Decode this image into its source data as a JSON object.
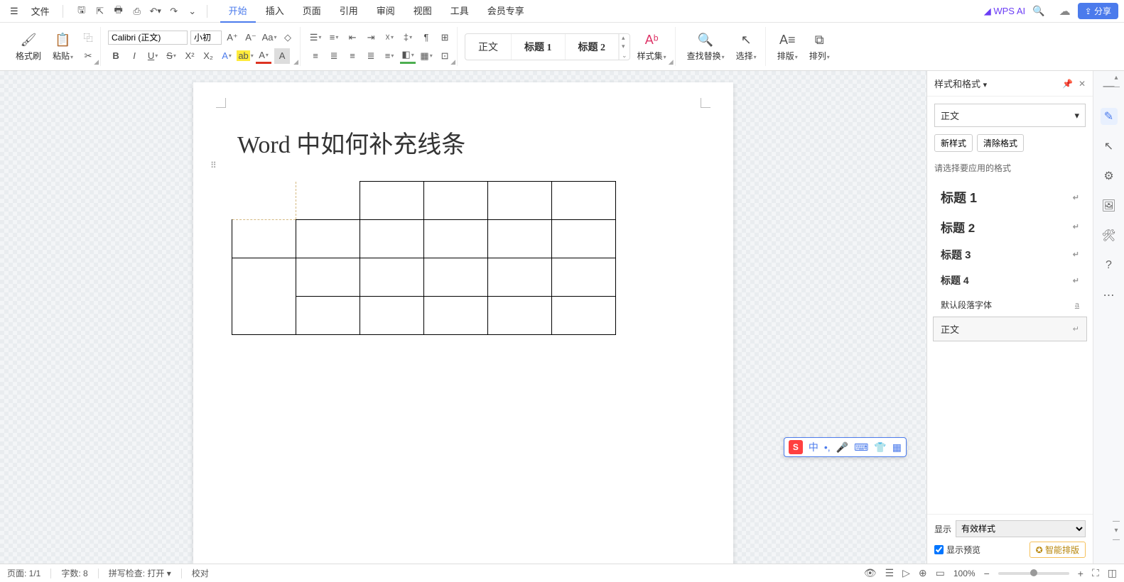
{
  "titlebar": {
    "file_label": "文件",
    "tabs": [
      "开始",
      "插入",
      "页面",
      "引用",
      "审阅",
      "视图",
      "工具",
      "会员专享"
    ],
    "active_tab": 0,
    "wpsai": "WPS AI",
    "share": "分享"
  },
  "ribbon": {
    "format_painter": "格式刷",
    "paste": "粘贴",
    "font_name": "Calibri (正文)",
    "font_size": "小初",
    "style_body": "正文",
    "style_h1": "标题 1",
    "style_h2": "标题 2",
    "style_set": "样式集",
    "find_replace": "查找替换",
    "select": "选择",
    "typeset": "排版",
    "arrange": "排列"
  },
  "document": {
    "title": "Word 中如何补充线条"
  },
  "rpanel": {
    "title": "样式和格式",
    "current_style": "正文",
    "new_style": "新样式",
    "clear_format": "清除格式",
    "hint": "请选择要应用的格式",
    "styles": [
      {
        "label": "标题 1",
        "cls": "h1"
      },
      {
        "label": "标题 2",
        "cls": "h2"
      },
      {
        "label": "标题 3",
        "cls": "h3"
      },
      {
        "label": "标题 4",
        "cls": "h4"
      },
      {
        "label": "默认段落字体",
        "cls": "def",
        "icon": "a"
      },
      {
        "label": "正文",
        "cls": "body"
      }
    ],
    "display_label": "显示",
    "display_value": "有效样式",
    "show_preview": "显示预览",
    "smart_layout": "智能排版"
  },
  "ime": {
    "lang": "中"
  },
  "statusbar": {
    "page": "页面: 1/1",
    "words": "字数: 8",
    "spell": "拼写检查: 打开",
    "proof": "校对",
    "zoom": "100%"
  }
}
